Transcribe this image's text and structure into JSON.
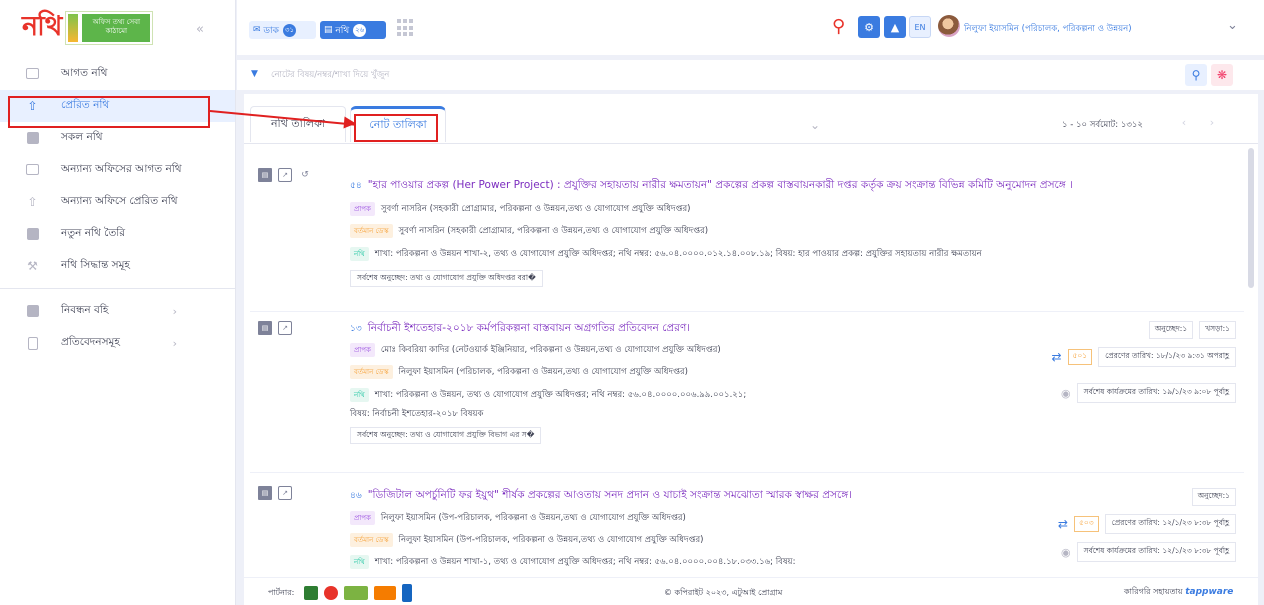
{
  "logo": {
    "main": "নথি",
    "tagline": "অফিস তথ্য সেবা কাঠামো"
  },
  "sidebar": {
    "items": [
      {
        "label": "আগত নথি"
      },
      {
        "label": "প্রেরিত নথি"
      },
      {
        "label": "সকল নথি"
      },
      {
        "label": "অন্যান্য অফিসের আগত নথি"
      },
      {
        "label": "অন্যান্য অফিসে প্রেরিত নথি"
      },
      {
        "label": "নতুন নথি তৈরি"
      },
      {
        "label": "নথি সিদ্ধান্ত সমূহ"
      }
    ],
    "groups": [
      {
        "label": "নিবন্ধন বহি"
      },
      {
        "label": "প্রতিবেদনসমূহ"
      }
    ]
  },
  "topbar": {
    "dak_label": "ডাক",
    "dak_count": "৩১",
    "nothi_label": "নথি",
    "nothi_count": "২৬",
    "lang": "EN",
    "user_name": "নিলুফা ইয়াসমিন (পরিচালক, পরিকল্পনা ও উন্নয়ন)"
  },
  "search": {
    "placeholder": "নোটের বিষয়/নম্বর/শাখা দিয়ে খুঁজুন"
  },
  "tabs": {
    "nothi_list": "নথি তালিকা",
    "note_list": "নোট তালিকা"
  },
  "pager": {
    "text": "১ - ১০ সর্বমোট: ১৩১২"
  },
  "labels": {
    "sender": "প্রাপক",
    "current": "বর্তমান ডেস্ক",
    "nothi": "নথি"
  },
  "notes": [
    {
      "num": "৫৪",
      "title": "\"হার পাওয়ার প্রকল্প (Her Power Project) : প্রযুক্তির সহায়তায় নারীর ক্ষমতায়ন\" প্রকল্পের প্রকল্প বাস্তবায়নকারী দপ্তর কর্তৃক ক্রয় সংক্রান্ত বিভিন্ন কমিটি অনুমোদন প্রসঙ্গে ।",
      "sender": "সুবর্ণা নাসরিন (সহকারী প্রোগ্রামার, পরিকল্পনা ও উন্নয়ন,তথ্য ও যোগাযোগ প্রযুক্তি অধিদপ্তর)",
      "current": "সুবর্ণা নাসরিন (সহকারী প্রোগ্রামার, পরিকল্পনা ও উন্নয়ন,তথ্য ও যোগাযোগ প্রযুক্তি অধিদপ্তর)",
      "nothi": "শাখা: পরিকল্পনা ও উন্নয়ন শাখা-২, তথ্য ও যোগাযোগ প্রযুক্তি অধিদপ্তর; নথি নম্বর: ৫৬.০৪.০০০০.০১২.১৪.০০৮.১৯; বিষয়: হার পাওয়ার প্রকল্প: প্রযুক্তির সহায়তায় নারীর ক্ষমতায়ন",
      "last_note": "সর্বশেষ অনুচ্ছেদ: তথ্য ও যোগাযোগ প্রযুক্তি অধিদপ্তর বরা�"
    },
    {
      "num": "১৩",
      "title": "নির্বাচনী ইশতেহার-২০১৮ কর্মপরিকল্পনা বাস্তবায়ন অগ্রগতির প্রতিবেদন প্রেরণ।",
      "sender": "মোঃ কিবরিয়া কাদির (নেটওয়ার্ক ইঞ্জিনিয়ার, পরিকল্পনা ও উন্নয়ন,তথ্য ও যোগাযোগ প্রযুক্তি অধিদপ্তর)",
      "current": "নিলুফা ইয়াসমিন (পরিচালক, পরিকল্পনা ও উন্নয়ন,তথ্য ও যোগাযোগ প্রযুক্তি অধিদপ্তর)",
      "nothi": "শাখা: পরিকল্পনা ও উন্নয়ন, তথ্য ও যোগাযোগ প্রযুক্তি অধিদপ্তর; নথি নম্বর: ৫৬.০৪.০০০০.০০৬.৯৯.০০১.২১;",
      "subject": "বিষয়: নির্বাচনী ইশতেহার-২০১৮ বিষয়ক",
      "last_note": "সর্বশেষ অনুচ্ছেদ: তথ্য ও যোগাযোগ প্রযুক্তি বিভাগ এর স�",
      "badge1": "অনুচ্ছেদ:১",
      "badge2": "খসড়া:১",
      "count": "৫০১",
      "sent_date": "প্রেরণের তারিখ: ১৮/১/২৩ ৯:৩১ অপরাহ্ণ",
      "last_action": "সর্বশেষ কার্যক্রমের তারিখ: ১৯/১/২৩ ৯:০৮ পূর্বাহ্ণ"
    },
    {
      "num": "৪৬",
      "title": "\"ডিজিটাল অপর্চুনিটি ফর ইয়ুথ\" শীর্ষক প্রকল্পের আওতায় সনদ প্রদান ও যাচাই সংক্রান্ত সমঝোতা স্মারক স্বাক্ষর প্রসঙ্গে।",
      "sender": "নিলুফা ইয়াসমিন (উপ-পরিচালক, পরিকল্পনা ও উন্নয়ন,তথ্য ও যোগাযোগ প্রযুক্তি অধিদপ্তর)",
      "current": "নিলুফা ইয়াসমিন (উপ-পরিচালক, পরিকল্পনা ও উন্নয়ন,তথ্য ও যোগাযোগ প্রযুক্তি অধিদপ্তর)",
      "nothi": "শাখা: পরিকল্পনা ও উন্নয়ন শাখা-১, তথ্য ও যোগাযোগ প্রযুক্তি অধিদপ্তর; নথি নম্বর: ৫৬.০৪.০০০০.০০৪.১৮.০৩৩.১৬; বিষয়:",
      "badge1": "অনুচ্ছেদ:১",
      "count": "৫০৩",
      "sent_date": "প্রেরণের তারিখ: ১২/১/২৩ ৮:৩৮ পূর্বাহ্ণ",
      "last_action": "সর্বশেষ কার্যক্রমের তারিখ: ১২/১/২৩ ৮:৩৮ পূর্বাহ্ণ"
    }
  ],
  "footer": {
    "partner_label": "পার্টনার:",
    "copyright": "© কপিরাইট ২০২৩, এটুআই প্রোগ্রাম",
    "tech_label": "কারিগরি সহায়তায়",
    "tech_brand": "tappware"
  }
}
